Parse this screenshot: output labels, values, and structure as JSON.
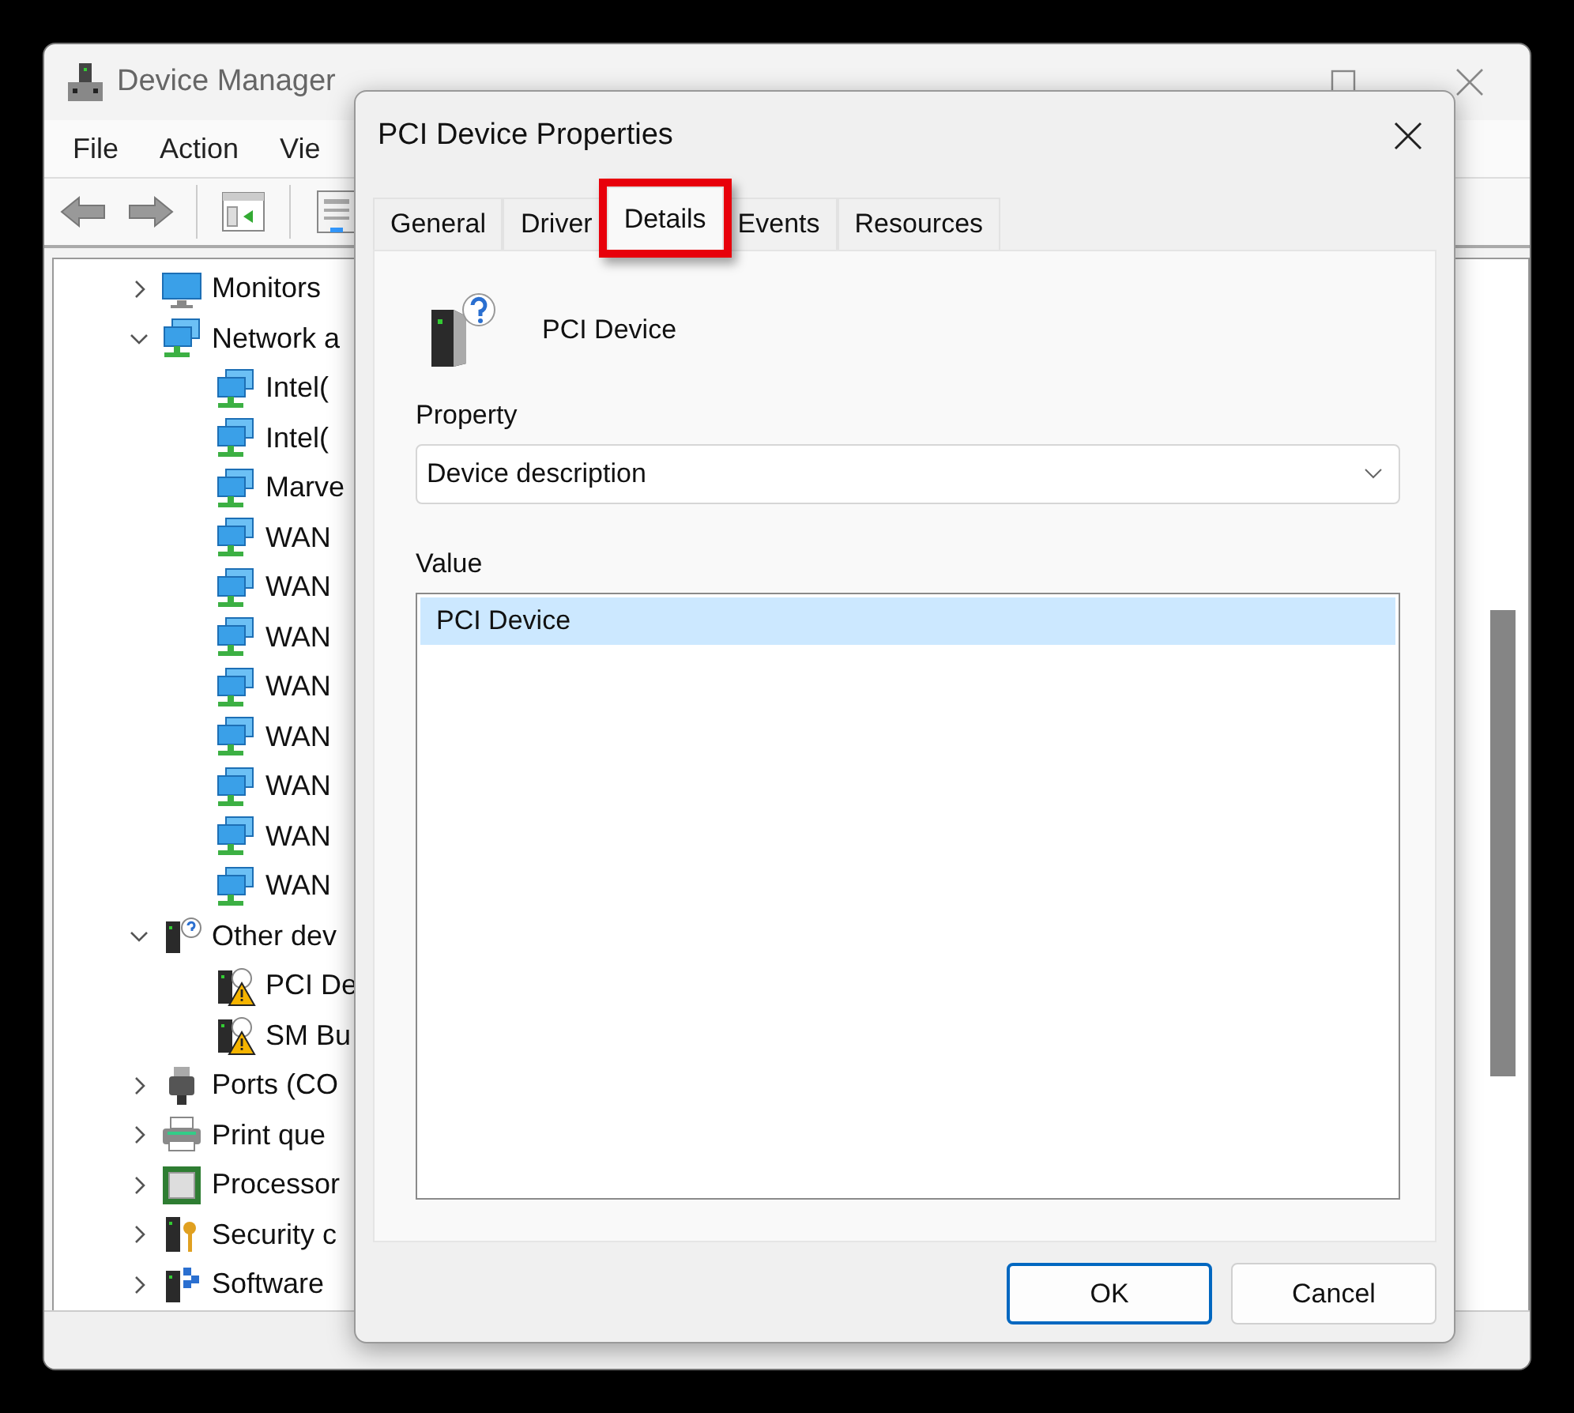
{
  "main_window": {
    "title": "Device Manager",
    "menu": [
      {
        "label": "File"
      },
      {
        "label": "Action"
      },
      {
        "label": "Vie"
      }
    ],
    "tree": [
      {
        "label": "Monitors",
        "kind": "monitor",
        "expanded": false
      },
      {
        "label": "Network a",
        "kind": "network",
        "expanded": true,
        "children": [
          {
            "label": "Intel(",
            "kind": "network"
          },
          {
            "label": "Intel(",
            "kind": "network"
          },
          {
            "label": "Marve",
            "kind": "network"
          },
          {
            "label": "WAN",
            "kind": "network"
          },
          {
            "label": "WAN",
            "kind": "network"
          },
          {
            "label": "WAN",
            "kind": "network"
          },
          {
            "label": "WAN",
            "kind": "network"
          },
          {
            "label": "WAN",
            "kind": "network"
          },
          {
            "label": "WAN",
            "kind": "network"
          },
          {
            "label": "WAN",
            "kind": "network"
          },
          {
            "label": "WAN",
            "kind": "network"
          }
        ]
      },
      {
        "label": "Other dev",
        "kind": "unknown",
        "expanded": true,
        "children": [
          {
            "label": "PCI De",
            "kind": "warning"
          },
          {
            "label": "SM Bu",
            "kind": "warning"
          }
        ]
      },
      {
        "label": "Ports (CO",
        "kind": "port",
        "expanded": false
      },
      {
        "label": "Print que",
        "kind": "printer",
        "expanded": false
      },
      {
        "label": "Processor",
        "kind": "processor",
        "expanded": false
      },
      {
        "label": "Security c",
        "kind": "security",
        "expanded": false
      },
      {
        "label": "Software",
        "kind": "software",
        "expanded": false
      }
    ]
  },
  "dialog": {
    "title": "PCI Device Properties",
    "tabs": [
      {
        "label": "General",
        "selected": false,
        "highlighted": false
      },
      {
        "label": "Driver",
        "selected": false,
        "highlighted": false
      },
      {
        "label": "Details",
        "selected": true,
        "highlighted": true
      },
      {
        "label": "Events",
        "selected": false,
        "highlighted": false
      },
      {
        "label": "Resources",
        "selected": false,
        "highlighted": false
      }
    ],
    "device_name": "PCI Device",
    "property_label": "Property",
    "property_value": "Device description",
    "value_label": "Value",
    "values": [
      {
        "text": "PCI Device",
        "selected": true
      }
    ],
    "buttons": [
      {
        "label": "OK",
        "default": true
      },
      {
        "label": "Cancel",
        "default": false
      }
    ]
  }
}
